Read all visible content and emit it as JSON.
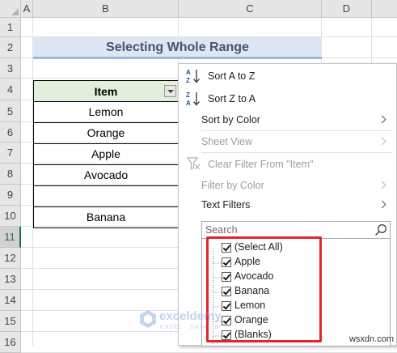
{
  "columns": [
    "A",
    "B",
    "C",
    "D"
  ],
  "rows": [
    "1",
    "2",
    "3",
    "4",
    "5",
    "6",
    "7",
    "8",
    "9",
    "10",
    "11",
    "12",
    "13",
    "14",
    "15",
    "16"
  ],
  "title": "Selecting Whole Range",
  "table": {
    "header": "Item",
    "items": [
      "Lemon",
      "Orange",
      "Apple",
      "Avocado",
      "",
      "Banana"
    ]
  },
  "menu": {
    "sort_az": "Sort A to Z",
    "sort_za": "Sort Z to A",
    "sort_color": "Sort by Color",
    "sheet_view": "Sheet View",
    "clear_filter": "Clear Filter From \"Item\"",
    "filter_color": "Filter by Color",
    "text_filters": "Text Filters",
    "search_placeholder": "Search",
    "list": [
      "(Select All)",
      "Apple",
      "Avocado",
      "Banana",
      "Lemon",
      "Orange",
      "(Blanks)"
    ]
  },
  "watermark": {
    "brand": "exceldemy",
    "sub": "EXCEL · DATA · BI"
  },
  "site_tag": "wsxdn.com",
  "colors": {
    "accent_green": "#217346",
    "highlight_red": "#e3242b",
    "title_fill": "#dde7f3",
    "header_fill": "#e2efda"
  }
}
